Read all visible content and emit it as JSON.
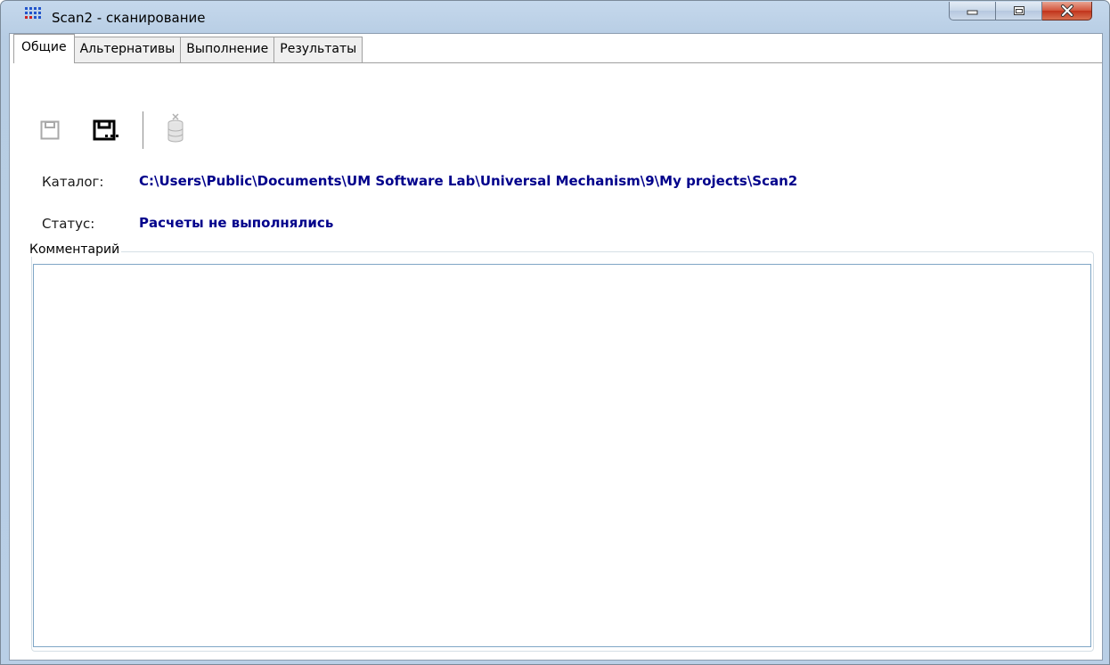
{
  "window": {
    "title": "Scan2 - сканирование",
    "controls": {
      "minimize": "minimize",
      "maximize": "maximize",
      "close": "close"
    }
  },
  "tabs": [
    {
      "label": "Общие",
      "active": true
    },
    {
      "label": "Альтернативы",
      "active": false
    },
    {
      "label": "Выполнение",
      "active": false
    },
    {
      "label": "Результаты",
      "active": false
    }
  ],
  "toolbar": {
    "icons": [
      "save-icon",
      "save-as-icon",
      "clear-database-icon"
    ]
  },
  "info": {
    "catalog_label": "Каталог:",
    "catalog_value": "C:\\Users\\Public\\Documents\\UM Software Lab\\Universal Mechanism\\9\\My projects\\Scan2",
    "status_label": "Статус:",
    "status_value": "Расчеты не выполнялись"
  },
  "comment": {
    "legend": "Комментарий",
    "value": ""
  },
  "colors": {
    "value_text": "#00008b",
    "frame": "#b9cfe6",
    "close_button": "#c1331b"
  }
}
